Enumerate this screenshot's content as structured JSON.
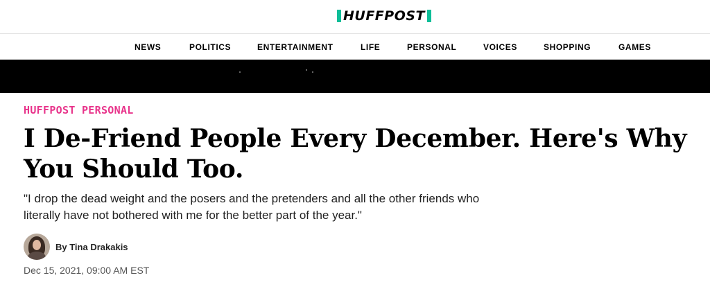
{
  "header": {
    "logo_text": "HUFFPOST",
    "brand_color": "#0dbe98"
  },
  "nav": {
    "items": [
      "NEWS",
      "POLITICS",
      "ENTERTAINMENT",
      "LIFE",
      "PERSONAL",
      "VOICES",
      "SHOPPING",
      "GAMES"
    ]
  },
  "article": {
    "section": "HUFFPOST PERSONAL",
    "section_color": "#e8348b",
    "headline": "I De-Friend People Every December. Here's Why You Should Too.",
    "dek": "\"I drop the dead weight and the posers and the pretenders and all the other friends who literally have not bothered with me for the better part of the year.\"",
    "byline": "By Tina Drakakis",
    "timestamp": "Dec 15, 2021, 09:00 AM EST"
  }
}
